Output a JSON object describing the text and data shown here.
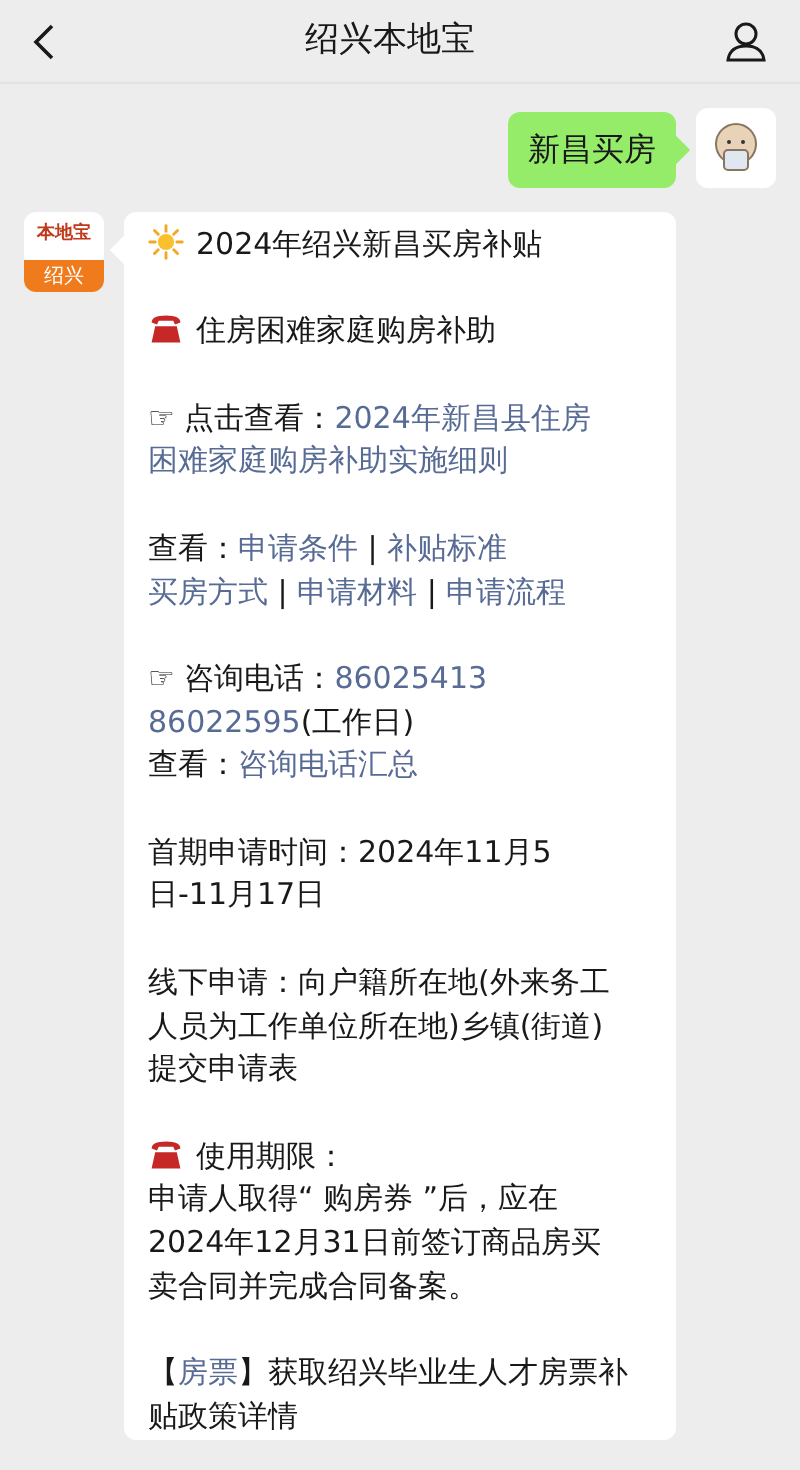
{
  "header": {
    "title": "绍兴本地宝"
  },
  "messages": [
    {
      "kind": "sent",
      "text": "新昌买房"
    },
    {
      "kind": "received",
      "avatar": {
        "logo_text": "本地宝",
        "badge": "绍兴"
      },
      "paragraphs": [
        {
          "kind": "sun",
          "lines": [
            [
              {
                "kind": "text",
                "text": "2024年绍兴新昌买房补贴"
              }
            ]
          ]
        },
        {
          "kind": "phone",
          "lines": [
            [
              {
                "kind": "text",
                "text": "住房困难家庭购房补助"
              }
            ]
          ]
        },
        {
          "kind": "plain",
          "lines": [
            [
              {
                "kind": "text",
                "text": "☞ 点击查看："
              },
              {
                "kind": "link",
                "text": "2024年新昌县住房"
              }
            ],
            [
              {
                "kind": "link",
                "text": "困难家庭购房补助实施细则"
              }
            ]
          ]
        },
        {
          "kind": "plain",
          "lines": [
            [
              {
                "kind": "text",
                "text": "查看："
              },
              {
                "kind": "link",
                "text": "申请条件"
              },
              {
                "kind": "text",
                "text": " | "
              },
              {
                "kind": "link",
                "text": "补贴标准"
              }
            ],
            [
              {
                "kind": "link",
                "text": "买房方式"
              },
              {
                "kind": "text",
                "text": " | "
              },
              {
                "kind": "link",
                "text": "申请材料"
              },
              {
                "kind": "text",
                "text": " | "
              },
              {
                "kind": "link",
                "text": "申请流程"
              }
            ]
          ]
        },
        {
          "kind": "plain",
          "lines": [
            [
              {
                "kind": "text",
                "text": "☞ 咨询电话："
              },
              {
                "kind": "link",
                "text": "86025413"
              }
            ],
            [
              {
                "kind": "link",
                "text": "86022595"
              },
              {
                "kind": "text",
                "text": "(工作日)"
              }
            ],
            [
              {
                "kind": "text",
                "text": "查看："
              },
              {
                "kind": "link",
                "text": "咨询电话汇总"
              }
            ]
          ]
        },
        {
          "kind": "plain",
          "lines": [
            [
              {
                "kind": "text",
                "text": "首期申请时间：2024年11月5"
              }
            ],
            [
              {
                "kind": "text",
                "text": "日-11月17日"
              }
            ]
          ]
        },
        {
          "kind": "plain",
          "lines": [
            [
              {
                "kind": "text",
                "text": "线下申请：向户籍所在地(外来务工"
              }
            ],
            [
              {
                "kind": "text",
                "text": "人员为工作单位所在地)乡镇(街道)"
              }
            ],
            [
              {
                "kind": "text",
                "text": "提交申请表"
              }
            ]
          ]
        },
        {
          "kind": "phone",
          "lines": [
            [
              {
                "kind": "text",
                "text": "使用期限："
              }
            ],
            [
              {
                "kind": "text",
                "text": "申请人取得“ 购房券 ”后，应在"
              }
            ],
            [
              {
                "kind": "text",
                "text": "2024年12月31日前签订商品房买"
              }
            ],
            [
              {
                "kind": "text",
                "text": "卖合同并完成合同备案。"
              }
            ]
          ]
        },
        {
          "kind": "plain",
          "lines": [
            [
              {
                "kind": "text",
                "text": "【"
              },
              {
                "kind": "link",
                "text": "房票"
              },
              {
                "kind": "text",
                "text": "】获取绍兴毕业生人才房票补"
              }
            ],
            [
              {
                "kind": "text",
                "text": "贴政策详情"
              }
            ]
          ]
        }
      ]
    }
  ]
}
